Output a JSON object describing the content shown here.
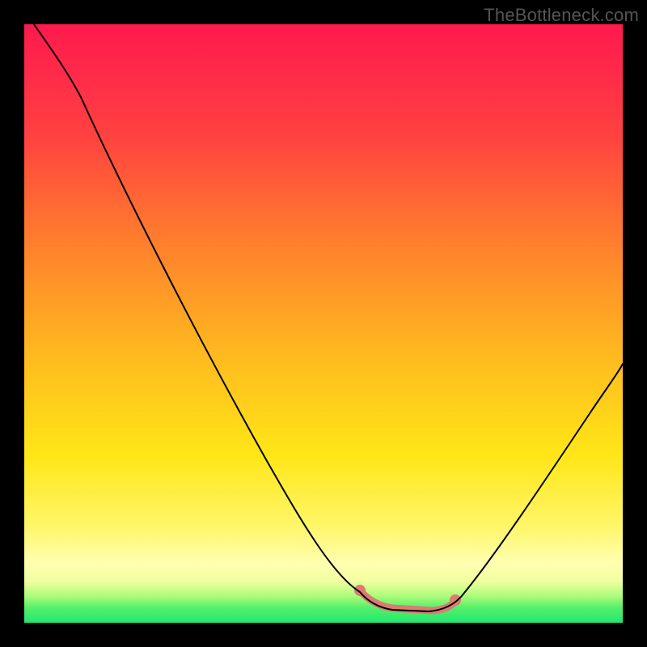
{
  "watermark": "TheBottleneck.com",
  "colors": {
    "background_black": "#000000",
    "curve": "#000000",
    "marker": "#db7b72",
    "gradient_top": "#ff1a4c",
    "gradient_mid": "#ffe617",
    "gradient_bottom": "#1fe870"
  },
  "chart_data": {
    "type": "line",
    "title": "",
    "xlabel": "",
    "ylabel": "",
    "xlim": [
      0,
      100
    ],
    "ylim": [
      0,
      100
    ],
    "grid": false,
    "legend": false,
    "series": [
      {
        "name": "bottleneck-curve",
        "x": [
          2,
          10,
          20,
          30,
          40,
          50,
          55,
          58,
          60,
          64,
          68,
          70,
          74,
          80,
          88,
          96,
          100
        ],
        "values": [
          100,
          87,
          70,
          54,
          38,
          21,
          12,
          6,
          3,
          1,
          1,
          1,
          2,
          6,
          16,
          30,
          39
        ]
      }
    ],
    "annotations": [
      {
        "kind": "highlight-range",
        "x_from": 56,
        "x_to": 72,
        "color": "#db7b72"
      },
      {
        "kind": "point",
        "x": 56,
        "y": 5,
        "color": "#db7b72"
      },
      {
        "kind": "point",
        "x": 71,
        "y": 4,
        "color": "#db7b72"
      }
    ],
    "note": "No axes, ticks, or numeric labels are visible in the image; x/y values are estimated from pixel positions on a 0–100 normalized domain. y=0 corresponds to the bottom green band (best / no bottleneck)."
  }
}
